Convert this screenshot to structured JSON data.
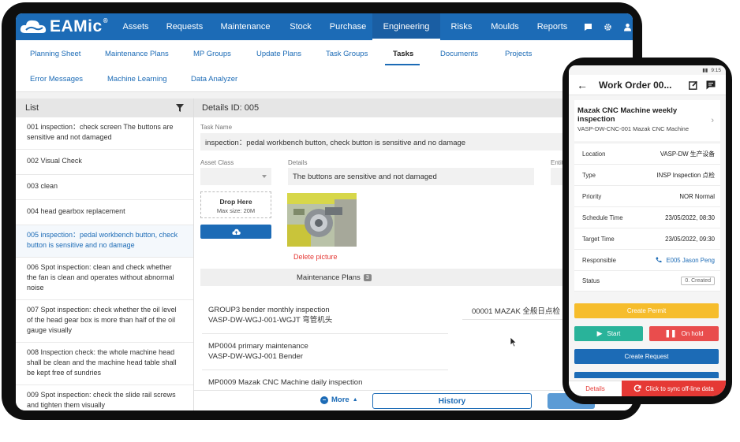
{
  "app": {
    "logo_text": "EAMic",
    "nav": [
      "Assets",
      "Requests",
      "Maintenance",
      "Stock",
      "Purchase",
      "Engineering",
      "Risks",
      "Moulds",
      "Reports"
    ],
    "active_nav": "Engineering",
    "nav_icons": [
      "chat-icon",
      "gear-icon",
      "user-icon"
    ]
  },
  "subnav": {
    "row1": [
      "Planning Sheet",
      "Maintenance Plans",
      "MP Groups",
      "Update Plans",
      "Task Groups",
      "Tasks",
      "Documents",
      "Projects"
    ],
    "row2": [
      "Error Messages",
      "Machine Learning",
      "Data Analyzer"
    ],
    "active": "Tasks"
  },
  "list": {
    "title": "List",
    "items": [
      "001 inspection：check screen The buttons are sensitive and not damaged",
      "002 Visual Check",
      "003 clean",
      "004 head gearbox replacement",
      "005 inspection：pedal workbench button, check button is sensitive and no damage",
      "006 Spot inspection: clean and check whether the fan is clean and operates without abnormal noise",
      "007 Spot inspection: check whether the oil level of the head gear box is more than half of the oil gauge visually",
      "008 Inspection check: the whole machine head shall be clean and the machine head table shall be kept free of sundries",
      "009 Spot inspection: check the slide rail screws and tighten them visually"
    ],
    "selected_index": 4
  },
  "details": {
    "header": "Details ID: 005",
    "task_name_label": "Task Name",
    "task_name_value": "inspection：pedal workbench button, check button is sensitive and no damage",
    "asset_class_label": "Asset Class",
    "details_label": "Details",
    "details_value": "The buttons are sensitive and not damaged",
    "entity_label": "Entity",
    "drop_title": "Drop Here",
    "drop_sub": "Max size: 20M",
    "delete_picture": "Delete picture",
    "mp_tab_label": "Maintenance Plans",
    "mp_count": "3",
    "second_tab_label": "T",
    "maintenance_plans": [
      {
        "name": "GROUP3 bender monthly inspection",
        "code": "VASP-DW-WGJ-001-WGJT 弯管机头"
      },
      {
        "name": "MP0004 primary maintenance",
        "code": "VASP-DW-WGJ-001 Bender"
      },
      {
        "name": "MP0009 Mazak CNC Machine daily inspection",
        "code": ""
      }
    ],
    "task_group_row": "00001 MAZAK 全般日点检 Insp",
    "more_label": "More",
    "history_label": "History"
  },
  "phone": {
    "time": "9:15",
    "title": "Work Order 00...",
    "card_title": "Mazak CNC Machine weekly inspection",
    "card_sub": "VASP-DW-CNC-001 Mazak CNC Machine",
    "rows": [
      {
        "label": "Location",
        "value": "VASP-DW 生产设备"
      },
      {
        "label": "Type",
        "value": "INSP Inspection 点检"
      },
      {
        "label": "Priority",
        "value": "NOR Normal"
      },
      {
        "label": "Schedule Time",
        "value": "23/05/2022, 08:30"
      },
      {
        "label": "Target Time",
        "value": "23/05/2022, 09:30"
      },
      {
        "label": "Responsible",
        "value": "E005 Jason Peng"
      },
      {
        "label": "Status",
        "value": "0. Created"
      }
    ],
    "btn_permit": "Create Permit",
    "btn_start": "Start",
    "btn_hold": "On hold",
    "btn_request": "Create Request",
    "bottom_details": "Details",
    "bottom_sync": "Click to sync off-line data"
  },
  "colors": {
    "brand_blue": "#1c6bb6",
    "permit_yellow": "#f6bd2c",
    "start_teal": "#29b39a",
    "hold_red": "#e94d4d",
    "sync_red": "#e53935"
  }
}
